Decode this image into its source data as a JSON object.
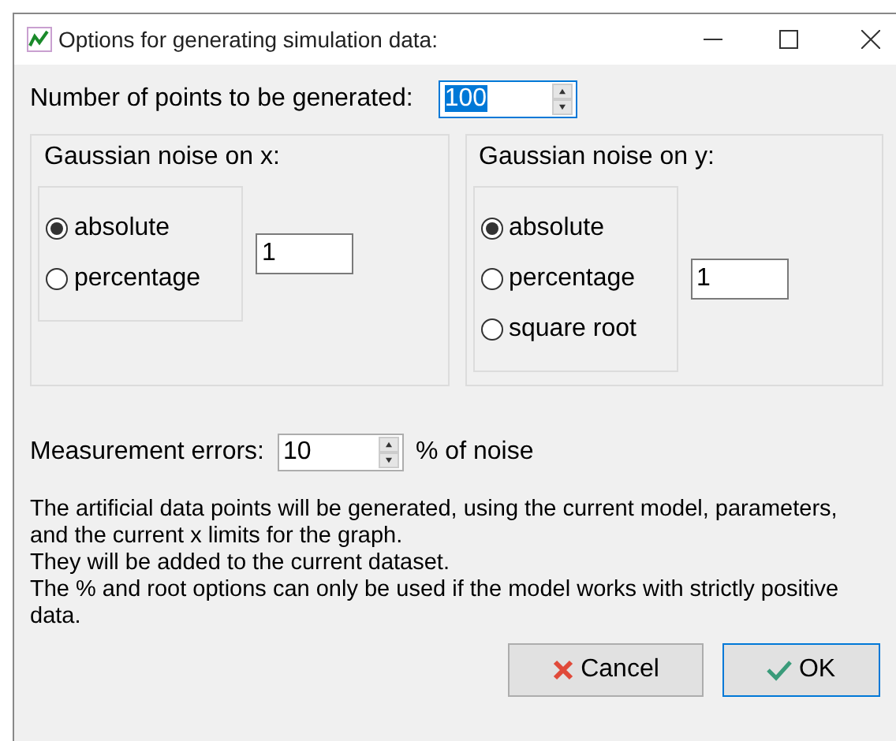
{
  "window": {
    "title": "Options for generating simulation data:"
  },
  "points": {
    "label": "Number of points to be generated:",
    "value": "100"
  },
  "noise_groups": [
    {
      "title": "Gaussian noise on x:",
      "value": "1",
      "options": [
        {
          "label": "absolute",
          "selected": true
        },
        {
          "label": "percentage",
          "selected": false
        }
      ]
    },
    {
      "title": "Gaussian noise on y:",
      "value": "1",
      "options": [
        {
          "label": "absolute",
          "selected": true
        },
        {
          "label": "percentage",
          "selected": false
        },
        {
          "label": "square root",
          "selected": false
        }
      ]
    }
  ],
  "measurement": {
    "label": "Measurement errors:",
    "value": "10",
    "suffix": "% of noise"
  },
  "info_lines": [
    "The artificial data points will be generated, using the current model, parameters, and the current x limits for the graph.",
    "They will be added to the current dataset.",
    "The % and root options can only be used if the model works with strictly positive data."
  ],
  "buttons": [
    {
      "kind": "cancel",
      "label": "Cancel"
    },
    {
      "kind": "ok",
      "label": "OK"
    }
  ]
}
